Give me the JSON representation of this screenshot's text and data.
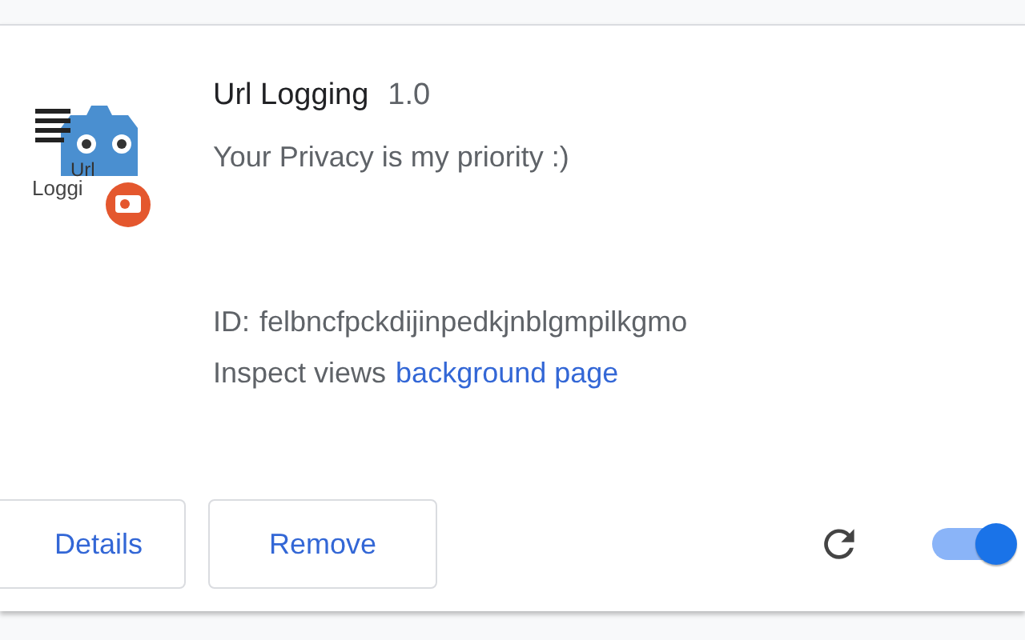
{
  "extension": {
    "icon_text": [
      "Url",
      "Loggi"
    ],
    "name": "Url Logging",
    "version": "1.0",
    "description": "Your Privacy is my priority :)",
    "id_label": "ID:",
    "id": "felbncfpckdijinpedkjnblgmpilkgmo",
    "inspect_label": "Inspect views",
    "inspect_link": "background page"
  },
  "buttons": [
    "Details",
    "Remove"
  ],
  "enabled": true
}
